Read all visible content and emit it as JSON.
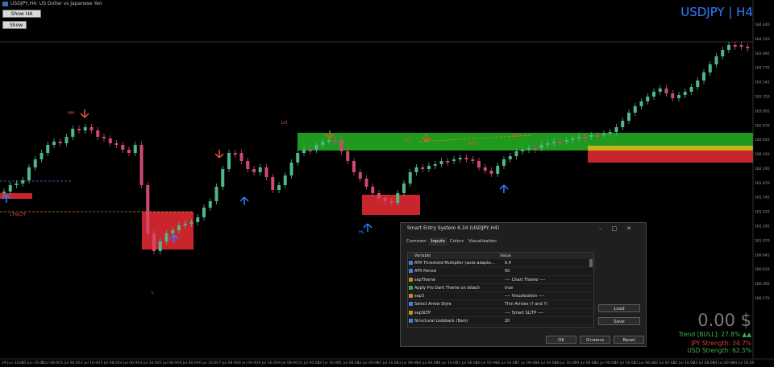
{
  "window": {
    "title": "USDJPY,H4: US Dollar vs Japanese Yen"
  },
  "chart_buttons": {
    "show_ha": "Show HA",
    "show": "Show"
  },
  "symbol_label": "USDJPY | H4",
  "balance": "0.00 $",
  "stats": {
    "trend": "Trend [BULL]: 27.8% ▲▲",
    "jpy": "JPY Strength: 34.7%",
    "usd": "USD Strength: 62.5%"
  },
  "colors": {
    "bull": "#4fb887",
    "bear": "#d14a6e",
    "up_arrow": "#2f7fff",
    "down_arrow": "#e0592b",
    "green_zone": "#1f9a1f",
    "red_zone": "#c9252d",
    "yellow_zone": "#c8b21a",
    "bull_text": "#3cb04a",
    "bear_text": "#e03b2f"
  },
  "chart_labels": {
    "hh": "HH",
    "lh1": "LH",
    "lh2": "LH",
    "hl": "HL",
    "l": "L",
    "choch": "CHoCH",
    "bos1": "BOS",
    "bos2": "BOS"
  },
  "price_axis": [
    "184.440",
    "184.220",
    "183.995",
    "183.770",
    "183.545",
    "183.320",
    "183.095",
    "182.870",
    "182.645",
    "182.420",
    "182.195",
    "181.970",
    "181.745",
    "181.520",
    "181.295",
    "181.070",
    "180.845",
    "180.620",
    "180.395",
    "180.170"
  ],
  "time_axis": [
    "29 Jun 2026",
    "30 Jun 16:00",
    "1 Jul 08:00",
    "2 Jul 00:00",
    "2 Jul 16:00",
    "3 Jul 08:00",
    "4 Jul 00:00",
    "4 Jul 16:00",
    "5 Jul 08:00",
    "6 Jul 00:00",
    "6 Jul 16:00",
    "7 Jul 08:00",
    "8 Jul 00:00",
    "8 Jul 16:00",
    "9 Jul 08:00",
    "10 Jul 00:00",
    "10 Jul 16:00",
    "11 Jul 08:00",
    "12 Jul 00:00",
    "12 Jul 16:00",
    "13 Jul 08:00",
    "14 Jul 00:00",
    "14 Jul 16:00",
    "15 Jul 08:00",
    "16 Jul 00:00",
    "16 Jul 16:00",
    "17 Jul 08:00",
    "18 Jul 00:00",
    "18 Jul 16:00",
    "19 Jul 08:00",
    "20 Jul 00:00",
    "20 Jul 16:00",
    "21 Jul 08:00",
    "22 Jul 00:00",
    "22 Jul 16:00",
    "23 Jul 08:00",
    "24 Jul 00:00",
    "24 Jul 16:00"
  ],
  "dialog": {
    "title": "Smart Entry System 6.34 (USDJPY,H4)",
    "tabs": [
      "Common",
      "Inputs",
      "Colors",
      "Visualization"
    ],
    "active_tab": 1,
    "col_variable": "Variable",
    "col_value": "Value",
    "rows": [
      {
        "name": "ATR Threshold Multiplier (auto-adapte...",
        "value": "0.4",
        "icon": "#4a7fd6"
      },
      {
        "name": "ATR Period",
        "value": "50",
        "icon": "#4a7fd6"
      },
      {
        "name": "sepTheme",
        "value": "---- Chart Theme ----",
        "icon": "#c8892a"
      },
      {
        "name": "Apply Pro Dark Theme on attach",
        "value": "true",
        "icon": "#34a853"
      },
      {
        "name": "sep3",
        "value": "---- Visualization ----",
        "icon": "#c8892a"
      },
      {
        "name": "Select Arrow Style",
        "value": "Thin Arrows (? and ?)",
        "icon": "#4a7fd6"
      },
      {
        "name": "sepSLTP",
        "value": "---- Smart SL/TP ----",
        "icon": "#c8892a"
      },
      {
        "name": "Structural Lookback (Bars)",
        "value": "20",
        "icon": "#4a7fd6"
      }
    ],
    "load": "Load",
    "save": "Save",
    "ok": "OK",
    "cancel": "Отмена",
    "reset": "Reset"
  }
}
